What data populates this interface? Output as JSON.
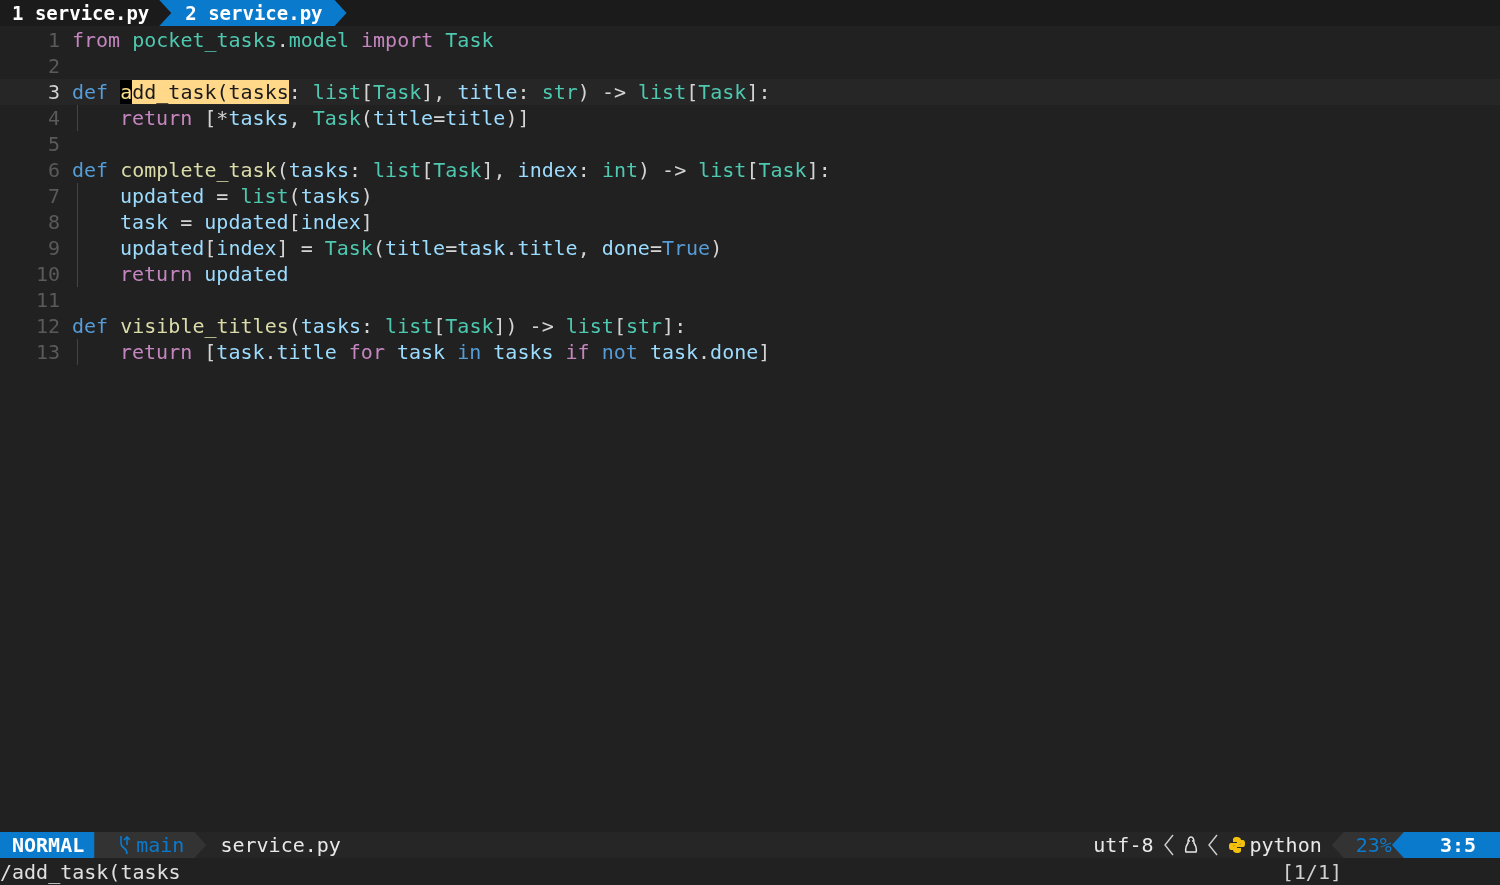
{
  "tabs": [
    {
      "label": "1 service.py",
      "selected": false
    },
    {
      "label": "2 service.py",
      "selected": true
    }
  ],
  "editor": {
    "lines": [
      {
        "number": "1",
        "current": false,
        "indent": false,
        "tokens": [
          {
            "kind": "keyword",
            "text": "from "
          },
          {
            "kind": "type",
            "text": "pocket_tasks"
          },
          {
            "kind": "plain",
            "text": "."
          },
          {
            "kind": "type",
            "text": "model "
          },
          {
            "kind": "keyword",
            "text": "import "
          },
          {
            "kind": "type",
            "text": "Task"
          }
        ]
      },
      {
        "number": "2",
        "current": false,
        "indent": false
      },
      {
        "number": "3",
        "current": true,
        "indent": false,
        "tokens": [
          {
            "kind": "storage",
            "text": "def "
          },
          {
            "kind": "cursor",
            "text": "a"
          },
          {
            "kind": "match",
            "text": "dd_task(tasks"
          },
          {
            "kind": "plain",
            "text": ": "
          },
          {
            "kind": "type",
            "text": "list"
          },
          {
            "kind": "plain",
            "text": "["
          },
          {
            "kind": "type",
            "text": "Task"
          },
          {
            "kind": "plain",
            "text": "], "
          },
          {
            "kind": "variable",
            "text": "title"
          },
          {
            "kind": "plain",
            "text": ": "
          },
          {
            "kind": "type",
            "text": "str"
          },
          {
            "kind": "plain",
            "text": ") -> "
          },
          {
            "kind": "type",
            "text": "list"
          },
          {
            "kind": "plain",
            "text": "["
          },
          {
            "kind": "type",
            "text": "Task"
          },
          {
            "kind": "plain",
            "text": "]:"
          }
        ]
      },
      {
        "number": "4",
        "current": false,
        "indent": true,
        "tokens": [
          {
            "kind": "keyword",
            "text": "return"
          },
          {
            "kind": "plain",
            "text": " [*"
          },
          {
            "kind": "variable",
            "text": "tasks"
          },
          {
            "kind": "plain",
            "text": ", "
          },
          {
            "kind": "type",
            "text": "Task"
          },
          {
            "kind": "plain",
            "text": "("
          },
          {
            "kind": "variable",
            "text": "title"
          },
          {
            "kind": "plain",
            "text": "="
          },
          {
            "kind": "variable",
            "text": "title"
          },
          {
            "kind": "plain",
            "text": ")]"
          }
        ]
      },
      {
        "number": "5",
        "current": false,
        "indent": false
      },
      {
        "number": "6",
        "current": false,
        "indent": false,
        "tokens": [
          {
            "kind": "storage",
            "text": "def "
          },
          {
            "kind": "function",
            "text": "complete_task"
          },
          {
            "kind": "plain",
            "text": "("
          },
          {
            "kind": "variable",
            "text": "tasks"
          },
          {
            "kind": "plain",
            "text": ": "
          },
          {
            "kind": "type",
            "text": "list"
          },
          {
            "kind": "plain",
            "text": "["
          },
          {
            "kind": "type",
            "text": "Task"
          },
          {
            "kind": "plain",
            "text": "], "
          },
          {
            "kind": "variable",
            "text": "index"
          },
          {
            "kind": "plain",
            "text": ": "
          },
          {
            "kind": "type",
            "text": "int"
          },
          {
            "kind": "plain",
            "text": ") -> "
          },
          {
            "kind": "type",
            "text": "list"
          },
          {
            "kind": "plain",
            "text": "["
          },
          {
            "kind": "type",
            "text": "Task"
          },
          {
            "kind": "plain",
            "text": "]:"
          }
        ]
      },
      {
        "number": "7",
        "current": false,
        "indent": true,
        "tokens": [
          {
            "kind": "variable",
            "text": "updated"
          },
          {
            "kind": "plain",
            "text": " = "
          },
          {
            "kind": "type",
            "text": "list"
          },
          {
            "kind": "plain",
            "text": "("
          },
          {
            "kind": "variable",
            "text": "tasks"
          },
          {
            "kind": "plain",
            "text": ")"
          }
        ]
      },
      {
        "number": "8",
        "current": false,
        "indent": true,
        "tokens": [
          {
            "kind": "variable",
            "text": "task"
          },
          {
            "kind": "plain",
            "text": " = "
          },
          {
            "kind": "variable",
            "text": "updated"
          },
          {
            "kind": "plain",
            "text": "["
          },
          {
            "kind": "variable",
            "text": "index"
          },
          {
            "kind": "plain",
            "text": "]"
          }
        ]
      },
      {
        "number": "9",
        "current": false,
        "indent": true,
        "tokens": [
          {
            "kind": "variable",
            "text": "updated"
          },
          {
            "kind": "plain",
            "text": "["
          },
          {
            "kind": "variable",
            "text": "index"
          },
          {
            "kind": "plain",
            "text": "] = "
          },
          {
            "kind": "type",
            "text": "Task"
          },
          {
            "kind": "plain",
            "text": "("
          },
          {
            "kind": "variable",
            "text": "title"
          },
          {
            "kind": "plain",
            "text": "="
          },
          {
            "kind": "variable",
            "text": "task"
          },
          {
            "kind": "plain",
            "text": "."
          },
          {
            "kind": "variable",
            "text": "title"
          },
          {
            "kind": "plain",
            "text": ", "
          },
          {
            "kind": "variable",
            "text": "done"
          },
          {
            "kind": "plain",
            "text": "="
          },
          {
            "kind": "storage",
            "text": "True"
          },
          {
            "kind": "plain",
            "text": ")"
          }
        ]
      },
      {
        "number": "10",
        "current": false,
        "indent": true,
        "tokens": [
          {
            "kind": "keyword",
            "text": "return "
          },
          {
            "kind": "variable",
            "text": "updated"
          }
        ]
      },
      {
        "number": "11",
        "current": false,
        "indent": false
      },
      {
        "number": "12",
        "current": false,
        "indent": false,
        "tokens": [
          {
            "kind": "storage",
            "text": "def "
          },
          {
            "kind": "function",
            "text": "visible_titles"
          },
          {
            "kind": "plain",
            "text": "("
          },
          {
            "kind": "variable",
            "text": "tasks"
          },
          {
            "kind": "plain",
            "text": ": "
          },
          {
            "kind": "type",
            "text": "list"
          },
          {
            "kind": "plain",
            "text": "["
          },
          {
            "kind": "type",
            "text": "Task"
          },
          {
            "kind": "plain",
            "text": "]) -> "
          },
          {
            "kind": "type",
            "text": "list"
          },
          {
            "kind": "plain",
            "text": "["
          },
          {
            "kind": "type",
            "text": "str"
          },
          {
            "kind": "plain",
            "text": "]:"
          }
        ]
      },
      {
        "number": "13",
        "current": false,
        "indent": true,
        "tokens": [
          {
            "kind": "keyword",
            "text": "return"
          },
          {
            "kind": "plain",
            "text": " ["
          },
          {
            "kind": "variable",
            "text": "task"
          },
          {
            "kind": "plain",
            "text": "."
          },
          {
            "kind": "variable",
            "text": "title "
          },
          {
            "kind": "keyword",
            "text": "for "
          },
          {
            "kind": "variable",
            "text": "task "
          },
          {
            "kind": "storage",
            "text": "in "
          },
          {
            "kind": "variable",
            "text": "tasks "
          },
          {
            "kind": "keyword",
            "text": "if "
          },
          {
            "kind": "storage",
            "text": "not "
          },
          {
            "kind": "variable",
            "text": "task"
          },
          {
            "kind": "plain",
            "text": "."
          },
          {
            "kind": "variable",
            "text": "done"
          },
          {
            "kind": "plain",
            "text": "]"
          }
        ]
      }
    ]
  },
  "status_bar": {
    "mode": "NORMAL",
    "branch": "main",
    "filename": "service.py",
    "encoding": "utf-8",
    "filetype": "python",
    "percent": "23%",
    "position": "3:5"
  },
  "command_line": {
    "text": "/add_task(tasks",
    "match_count": "[1/1]"
  }
}
